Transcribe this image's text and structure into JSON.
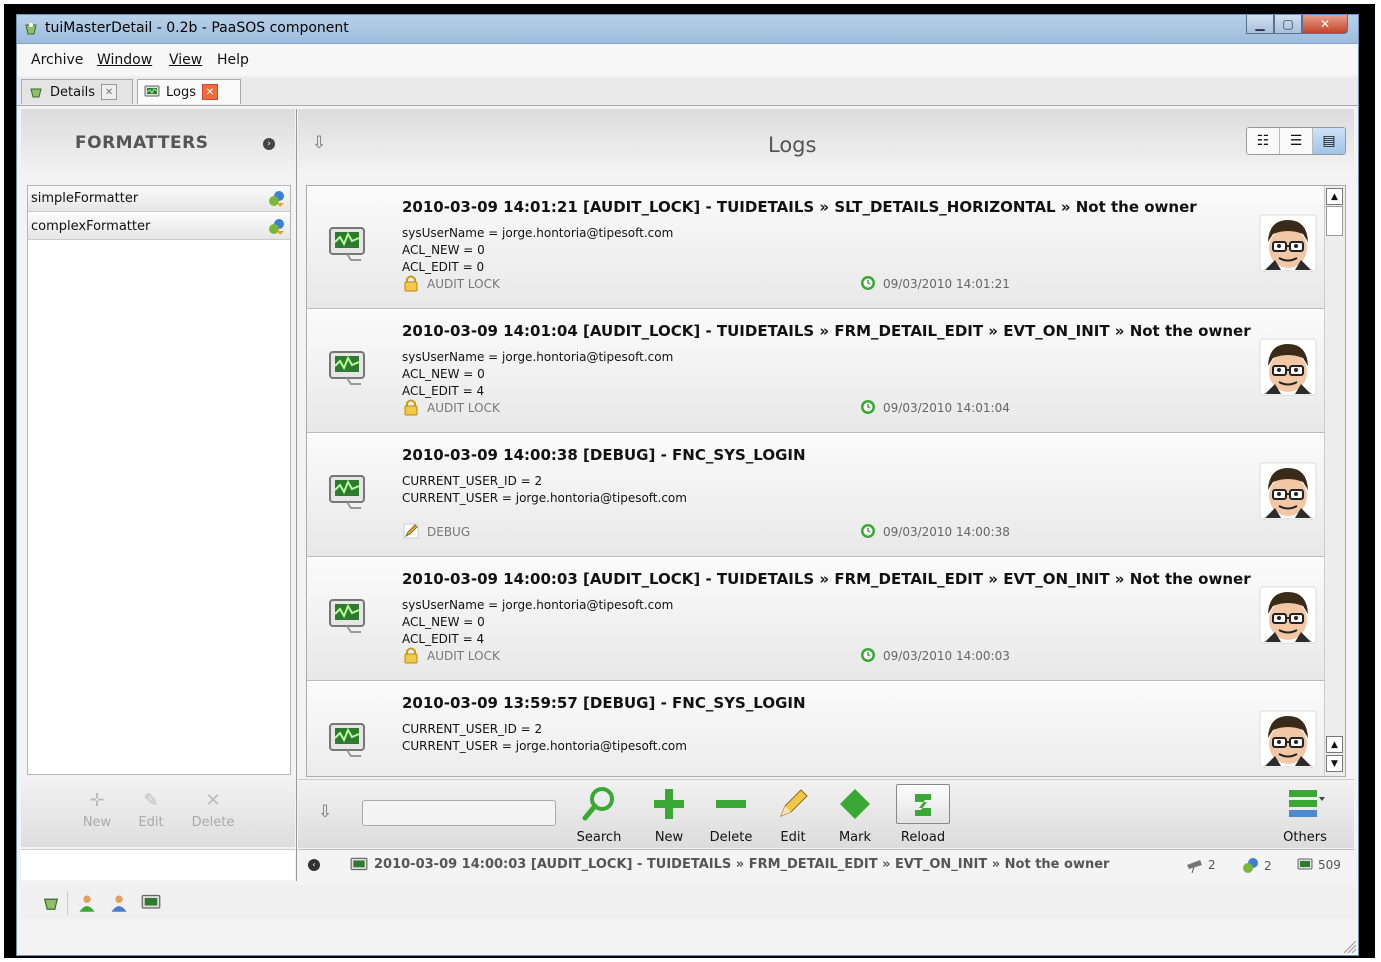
{
  "window": {
    "title": "tuiMasterDetail - 0.2b - PaaSOS component",
    "icon": "app-icon"
  },
  "menu": {
    "items": [
      "Archive",
      "Window",
      "View",
      "Help"
    ]
  },
  "tabs": [
    {
      "label": "Details",
      "icon": "details-icon",
      "active": false
    },
    {
      "label": "Logs",
      "icon": "monitor-icon",
      "active": true
    }
  ],
  "left": {
    "header": "FORMATTERS",
    "items": [
      {
        "label": "simpleFormatter",
        "icon": "formatter-icon"
      },
      {
        "label": "complexFormatter",
        "icon": "formatter-icon"
      }
    ],
    "buttons": {
      "new": "New",
      "edit": "Edit",
      "delete": "Delete"
    }
  },
  "main": {
    "header": "Logs",
    "view_modes": [
      "detail-view-icon",
      "list-view-icon",
      "tiles-view-icon"
    ],
    "entries": [
      {
        "title": "2010-03-09 14:01:21 [AUDIT_LOCK] - TUIDETAILS » SLT_DETAILS_HORIZONTAL » Not the owner",
        "lines": [
          "sysUserName = jorge.hontoria@tipesoft.com",
          "ACL_NEW = 0",
          "ACL_EDIT = 0"
        ],
        "type": "AUDIT LOCK",
        "type_icon": "lock-icon",
        "timestamp": "09/03/2010 14:01:21"
      },
      {
        "title": "2010-03-09 14:01:04 [AUDIT_LOCK] - TUIDETAILS » FRM_DETAIL_EDIT » EVT_ON_INIT » Not the owner",
        "lines": [
          "sysUserName = jorge.hontoria@tipesoft.com",
          "ACL_NEW = 0",
          "ACL_EDIT = 4"
        ],
        "type": "AUDIT LOCK",
        "type_icon": "lock-icon",
        "timestamp": "09/03/2010 14:01:04"
      },
      {
        "title": "2010-03-09 14:00:38 [DEBUG] - FNC_SYS_LOGIN",
        "lines": [
          "CURRENT_USER_ID = 2",
          "CURRENT_USER = jorge.hontoria@tipesoft.com",
          ""
        ],
        "type": "DEBUG",
        "type_icon": "pencil-icon",
        "timestamp": "09/03/2010 14:00:38"
      },
      {
        "title": "2010-03-09 14:00:03 [AUDIT_LOCK] - TUIDETAILS » FRM_DETAIL_EDIT » EVT_ON_INIT » Not the owner",
        "lines": [
          "sysUserName = jorge.hontoria@tipesoft.com",
          "ACL_NEW = 0",
          "ACL_EDIT = 4"
        ],
        "type": "AUDIT LOCK",
        "type_icon": "lock-icon",
        "timestamp": "09/03/2010 14:00:03"
      },
      {
        "title": "2010-03-09 13:59:57 [DEBUG] - FNC_SYS_LOGIN",
        "lines": [
          "CURRENT_USER_ID = 2",
          "CURRENT_USER = jorge.hontoria@tipesoft.com",
          ""
        ],
        "type": "",
        "type_icon": "pencil-icon",
        "timestamp": ""
      }
    ]
  },
  "toolbar": {
    "search_placeholder": "",
    "search": "Search",
    "new": "New",
    "delete": "Delete",
    "edit": "Edit",
    "mark": "Mark",
    "reload": "Reload",
    "others": "Others"
  },
  "status": {
    "text": "2010-03-09 14:00:03 [AUDIT_LOCK] - TUIDETAILS » FRM_DETAIL_EDIT » EVT_ON_INIT » Not the owner",
    "count_a": "2",
    "count_b": "2",
    "count_c": "509"
  },
  "colors": {
    "accent": "#9fc3e8",
    "green": "#3aa835",
    "title_gradient": "#b9d1ea",
    "close": "#c4432a"
  }
}
